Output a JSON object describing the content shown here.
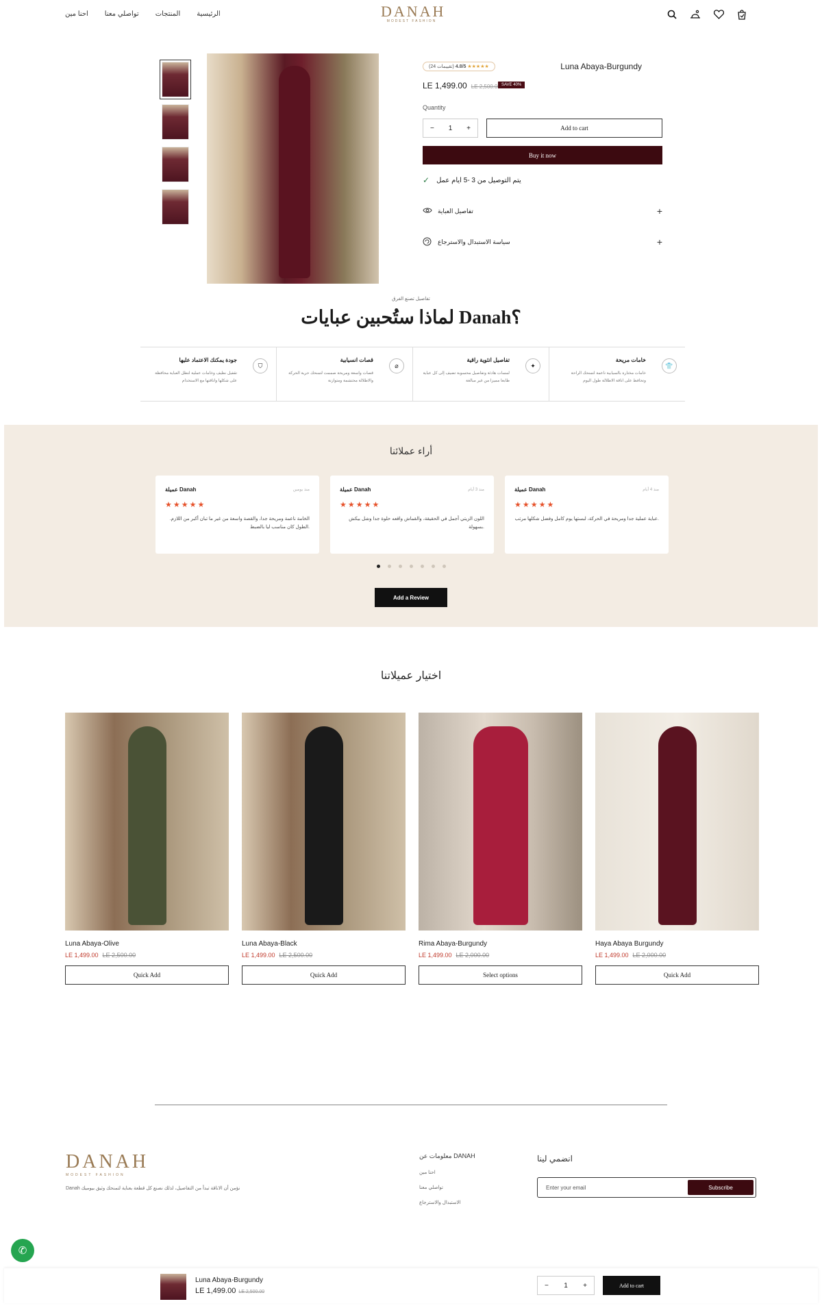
{
  "header": {
    "nav": [
      "الرئيسية",
      "المنتجات",
      "تواصلي معنا",
      "احنا مين"
    ],
    "logo_main": "DANAH",
    "logo_sub": "MODEST FASHION"
  },
  "product": {
    "name": "Luna Abaya-Burgundy",
    "rating_text": "4.8/5",
    "rating_count": "(24 تقييمات)",
    "rating_stars": "★★★★★",
    "price": "LE 1,499.00",
    "old_price": "LE 2,500.00",
    "save_badge": "SAVE 40%",
    "quantity_label": "Quantity",
    "quantity": "1",
    "add_to_cart": "Add to cart",
    "buy_now": "Buy it now",
    "delivery": "يتم التوصيل من 3 -5 ايام عمل",
    "accordions": [
      "تفاصيل العباية",
      "سياسة الاستبدال والاسترجاع"
    ]
  },
  "why": {
    "eyebrow": "تفاصيل تصنع الفرق",
    "title": "لماذا ستُحبين عبايات Danah؟",
    "features": [
      {
        "title": "خامات مريحة",
        "desc": "خامات مختارة بالسيابية ناعمة لتمنحك الراحة وتحافظ على اناقة الاطلالة طول اليوم"
      },
      {
        "title": "تفاصيل انثوية راقية",
        "desc": "لمسات هادئة وتفاصيل محسوبة تضيف إلى كل عباية طابعا مميزا من غير مبالغة"
      },
      {
        "title": "قصات انسيابية",
        "desc": "قصات واسعة ومريحة صممت لتمنحك حرية الحركة والاطلالة محتشمة ومتوازنة"
      },
      {
        "title": "جودة يمكنك الاعتماد عليها",
        "desc": "تقفيل نظيف وخامات عملية لتظل العباية محافظة على شكلها واناقتها مع الاستخدام"
      }
    ]
  },
  "reviews": {
    "title": "أراء عملائنا",
    "items": [
      {
        "name": "عميلة Danah",
        "date": "منذ يومين",
        "stars": "★★★★★",
        "text": "الخامة ناعمة ومريحة جدا، والقصة واسعة من غير ما تبان أكبر من اللازم. الطول كان مناسب ليا بالضبط."
      },
      {
        "name": "عميلة Danah",
        "date": "منذ 3 أيام",
        "stars": "★★★★★",
        "text": "اللون الزيتي أجمل في الحقيقة، والقماش واقعه حلوة جدا وشل بيكش بسهولة."
      },
      {
        "name": "عميلة Danah",
        "date": "منذ 4 أيام",
        "stars": "★★★★★",
        "text": "عباية عملية جدا ومريحة في الحركة، لبستها يوم كامل وفضل شكلها مرتب."
      }
    ],
    "add_review": "Add a Review"
  },
  "picks": {
    "title": "اختيار عميلاتنا",
    "items": [
      {
        "name": "Luna Abaya-Olive",
        "price": "LE 1,499.00",
        "old_price": "LE 2,500.00",
        "button": "Quick Add",
        "color": "#4a5236"
      },
      {
        "name": "Luna Abaya-Black",
        "price": "LE 1,499.00",
        "old_price": "LE 2,500.00",
        "button": "Quick Add",
        "color": "#1a1a1a"
      },
      {
        "name": "Rima Abaya-Burgundy",
        "price": "LE 1,499.00",
        "old_price": "LE 2,000.00",
        "button": "Select options",
        "color": "#a81e3c"
      },
      {
        "name": "Haya Abaya Burgundy",
        "price": "LE 1,499.00",
        "old_price": "LE 2,000.00",
        "button": "Quick Add",
        "color": "#5a1320"
      }
    ]
  },
  "footer": {
    "logo_main": "DANAH",
    "logo_sub": "MODEST FASHION",
    "tagline": "Danah نؤمن أن الاناقة تبدأ من التفاصيل، لذلك نصنع كل قطعة بعناية لتمنحك وثيق بيوميك",
    "links_title": "معلومات عن DANAH",
    "links": [
      "احنا مين",
      "تواصلي معنا",
      "الاستبدال والاسترجاع"
    ],
    "join_title": "انضمي لينا",
    "email_placeholder": "Enter your email",
    "subscribe": "Subscribe"
  },
  "sticky": {
    "name": "Luna Abaya-Burgundy",
    "price": "LE 1,499.00",
    "old_price": "LE 2,500.00",
    "quantity": "1",
    "add_to_cart": "Add to cart"
  }
}
